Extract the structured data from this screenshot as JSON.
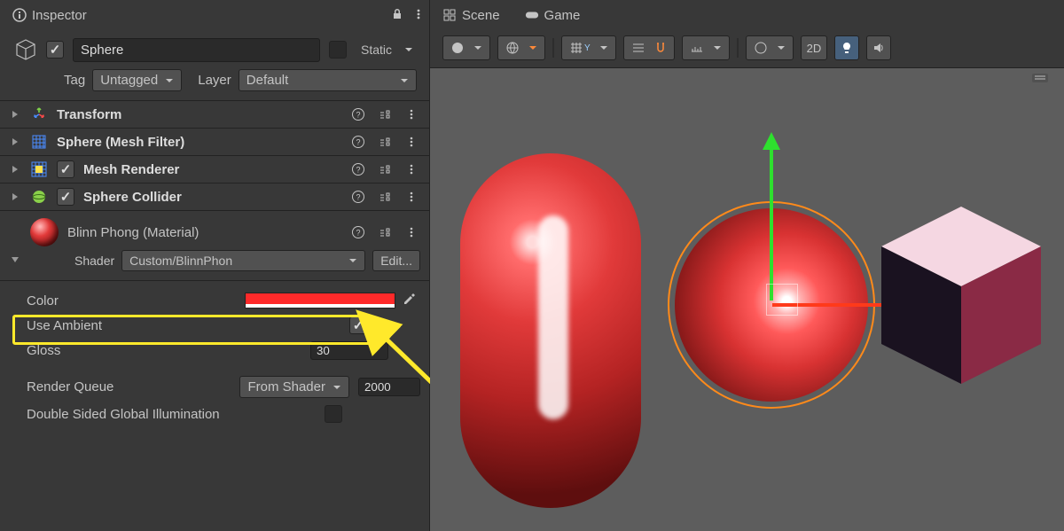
{
  "inspector": {
    "tab_label": "Inspector",
    "object_name": "Sphere",
    "static_label": "Static",
    "tag_label": "Tag",
    "tag_value": "Untagged",
    "layer_label": "Layer",
    "layer_value": "Default",
    "components": [
      {
        "name": "Transform",
        "has_checkbox": false
      },
      {
        "name": "Sphere (Mesh Filter)",
        "has_checkbox": false
      },
      {
        "name": "Mesh Renderer",
        "has_checkbox": true
      },
      {
        "name": "Sphere Collider",
        "has_checkbox": true
      }
    ],
    "material": {
      "name": "Blinn Phong (Material)",
      "shader_label": "Shader",
      "shader_value": "Custom/BlinnPhon",
      "edit_label": "Edit...",
      "props": {
        "color_label": "Color",
        "color_value": "#ff2a2a",
        "use_ambient_label": "Use Ambient",
        "use_ambient_checked": true,
        "gloss_label": "Gloss",
        "gloss_value": "30"
      },
      "render_queue_label": "Render Queue",
      "render_queue_source": "From Shader",
      "render_queue_value": "2000",
      "double_sided_label": "Double Sided Global Illumination"
    }
  },
  "scene": {
    "tab_scene": "Scene",
    "tab_game": "Game",
    "btn_2d": "2D"
  }
}
